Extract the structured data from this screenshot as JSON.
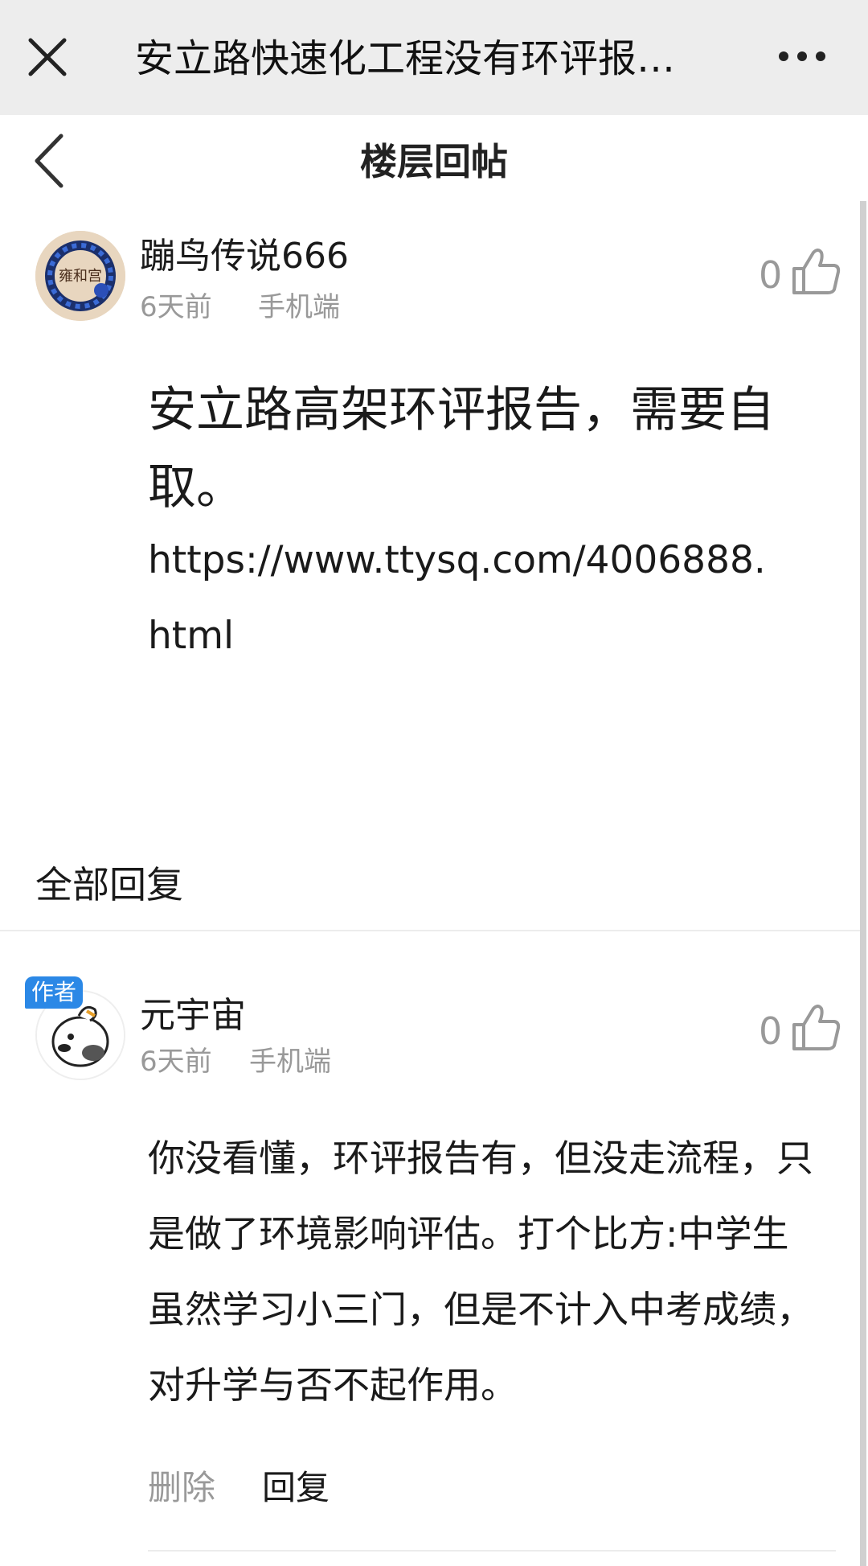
{
  "window": {
    "title": "安立路快速化工程没有环评报…"
  },
  "subheader": {
    "title": "楼层回帖"
  },
  "post": {
    "username": "蹦鸟传说666",
    "time": "6天前",
    "source": "手机端",
    "likes": "0",
    "text": "安立路高架环评报告，需要自取。",
    "link": "https://www.ttysq.com/4006888.html",
    "avatar_text": "雍和宫"
  },
  "replies_section": {
    "title": "全部回复"
  },
  "reply": {
    "badge": "作者",
    "username": "元宇宙",
    "time": "6天前",
    "source": "手机端",
    "likes": "0",
    "text": "你没看懂，环评报告有，但没走流程，只是做了环境影响评估。打个比方:中学生虽然学习小三门，但是不计入中考成绩，对升学与否不起作用。",
    "delete_label": "删除",
    "reply_label": "回复"
  }
}
